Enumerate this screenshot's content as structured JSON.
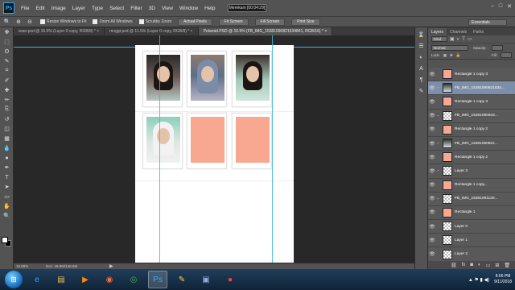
{
  "menubar": {
    "logo": "Ps",
    "items": [
      "File",
      "Edit",
      "Image",
      "Layer",
      "Type",
      "Select",
      "Filter",
      "3D",
      "View",
      "Window",
      "Help"
    ],
    "recording": "Merekam [00:04:29]",
    "window_controls": [
      "–",
      "□",
      "✕"
    ]
  },
  "options": {
    "resize_windows": "Resize Windows to Fit",
    "zoom_all_windows": "Zoom All Windows",
    "scrubby_zoom": "Scrubby Zoom",
    "actual_pixels": "Actual Pixels",
    "fit_screen": "Fit Screen",
    "fill_screen": "Fill Screen",
    "print_size": "Print Size",
    "workspace": "Essentials"
  },
  "tabs": [
    {
      "label": "iwan.psd @ 16.9% (Layer 0 copy, RGB/8) *  ×",
      "active": false
    },
    {
      "label": "mnggt.psd @ 11.5% (Layer 0 copy, RGB/8) *  ×",
      "active": false
    },
    {
      "label": "Polaroid.PSD @ 16.9% (FB_IMG_1538109082153484​1, RGB/16) *  ×",
      "active": true
    }
  ],
  "toolbar": {
    "tools": [
      "move-icon",
      "marquee-icon",
      "lasso-icon",
      "quick-select-icon",
      "crop-icon",
      "eyedropper-icon",
      "healing-icon",
      "brush-icon",
      "stamp-icon",
      "history-brush-icon",
      "eraser-icon",
      "gradient-icon",
      "blur-icon",
      "dodge-icon",
      "pen-icon",
      "type-icon",
      "path-select-icon",
      "shape-icon",
      "hand-icon",
      "zoom-icon"
    ],
    "glyphs": [
      "✥",
      "⬚",
      "ʘ",
      "✎",
      "⌗",
      "✐",
      "✚",
      "✏",
      "⎘",
      "↺",
      "◫",
      "▦",
      "💧",
      "●",
      "✒",
      "T",
      "➤",
      "▭",
      "✋",
      "🔍"
    ]
  },
  "status": {
    "zoom": "16.88%",
    "doc_size": "Doc: 49.8M/146.6M",
    "arrow": "▶"
  },
  "panels": {
    "tabs": [
      "Layers",
      "Channels",
      "Paths"
    ],
    "filter_kind": "Kind",
    "blend_mode": "Normal",
    "opacity_label": "Opacity:",
    "lock_label": "Lock:",
    "fill_label": "Fill:"
  },
  "layers": [
    {
      "name": "Rectangle 1 copy 3",
      "thumb": "peach",
      "selected": false,
      "linked": false
    },
    {
      "name": "FB_IMG_15381090821534...",
      "thumb": "photo",
      "selected": true,
      "linked": true
    },
    {
      "name": "Rectangle 1 copy 3",
      "thumb": "peach",
      "selected": false,
      "linked": false
    },
    {
      "name": "FB_IMG_15381090942...",
      "thumb": "checker",
      "selected": false,
      "linked": true
    },
    {
      "name": "Rectangle 1 copy 2",
      "thumb": "peach",
      "selected": false,
      "linked": false
    },
    {
      "name": "FB_IMG_15381090821...",
      "thumb": "photo",
      "selected": false,
      "linked": true
    },
    {
      "name": "Rectangle 1 copy 2",
      "thumb": "peach",
      "selected": false,
      "linked": false
    },
    {
      "name": "Layer 3",
      "thumb": "checker",
      "selected": false,
      "linked": true
    },
    {
      "name": "Rectangle 1 copy...",
      "thumb": "peach",
      "selected": false,
      "linked": false
    },
    {
      "name": "FB_IMG_15381091130...",
      "thumb": "checker",
      "selected": false,
      "linked": true
    },
    {
      "name": "Rectangle 1",
      "thumb": "peach",
      "selected": false,
      "linked": false
    },
    {
      "name": "Layer 0",
      "thumb": "checker",
      "selected": false,
      "linked": false
    },
    {
      "name": "Layer 1",
      "thumb": "checker",
      "selected": false,
      "linked": false
    },
    {
      "name": "Layer 2",
      "thumb": "checker",
      "selected": false,
      "linked": false
    }
  ],
  "taskbar": {
    "apps": [
      {
        "name": "ie-icon",
        "glyph": "e",
        "color": "#3aa0ff"
      },
      {
        "name": "explorer-icon",
        "glyph": "▤",
        "color": "#f2c14e"
      },
      {
        "name": "media-player-icon",
        "glyph": "▶",
        "color": "#ff8a00"
      },
      {
        "name": "firefox-icon",
        "glyph": "◉",
        "color": "#ff7139"
      },
      {
        "name": "chrome-icon",
        "glyph": "◎",
        "color": "#4caf50"
      },
      {
        "name": "photoshop-icon",
        "glyph": "Ps",
        "color": "#31a8ff"
      },
      {
        "name": "tools-icon",
        "glyph": "✎",
        "color": "#ffd24d"
      },
      {
        "name": "camera-icon",
        "glyph": "▣",
        "color": "#9ad"
      },
      {
        "name": "recorder-icon",
        "glyph": "●",
        "color": "#ff4444"
      }
    ],
    "time": "8:06 PM",
    "date": "9/11/2018",
    "tray": "▲ ⚑ ▮ ◀)"
  },
  "colors": {
    "accent": "#31a8ff",
    "peach": "#f8a890",
    "guide": "#3fb6d9"
  }
}
